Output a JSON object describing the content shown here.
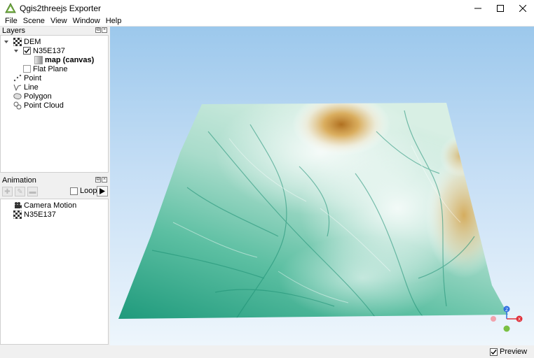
{
  "window": {
    "title": "Qgis2threejs Exporter",
    "controls": [
      "minimize-icon",
      "maximize-icon",
      "close-icon"
    ]
  },
  "menu": [
    "File",
    "Scene",
    "View",
    "Window",
    "Help"
  ],
  "layers_panel": {
    "title": "Layers",
    "items": [
      {
        "label": "DEM",
        "icon": "dem-icon"
      },
      {
        "label": "N35E137",
        "icon": "checkbox-checked"
      },
      {
        "label": "map (canvas)",
        "icon": "map-icon"
      },
      {
        "label": "Flat Plane",
        "icon": "checkbox-empty"
      },
      {
        "label": "Point",
        "icon": "point-icon"
      },
      {
        "label": "Line",
        "icon": "line-icon"
      },
      {
        "label": "Polygon",
        "icon": "polygon-icon"
      },
      {
        "label": "Point Cloud",
        "icon": "point-cloud-icon"
      }
    ]
  },
  "animation_panel": {
    "title": "Animation",
    "loop_label": "Loop",
    "loop_checked": false,
    "items": [
      {
        "label": "Camera Motion",
        "icon": "camera-icon"
      },
      {
        "label": "N35E137",
        "icon": "dem-icon"
      }
    ]
  },
  "axes": {
    "x": "X",
    "z": "Z"
  },
  "status": {
    "preview_label": "Preview",
    "preview_checked": true
  },
  "colors": {
    "sky_top": "#9cc8ec",
    "terrain_low": "#2aa083",
    "terrain_mid": "#e8f0ea",
    "terrain_high": "#c08a3a",
    "axis_x": "#e0303a",
    "axis_y": "#7ac043",
    "axis_z": "#2f6fe0"
  }
}
